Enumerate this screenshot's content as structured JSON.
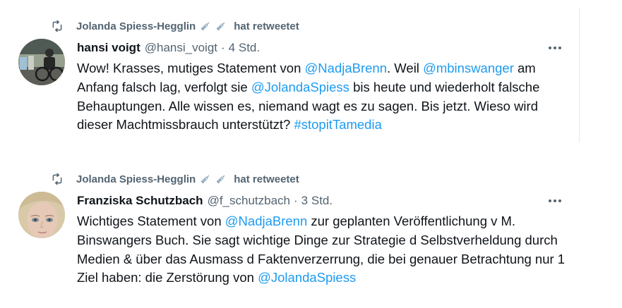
{
  "tweets": [
    {
      "retweeter": "Jolanda Spiess-Hegglin",
      "retweet_suffix": "hat retweetet",
      "author_name": "hansi voigt",
      "author_handle": "@hansi_voigt",
      "separator": "·",
      "time": "4 Std.",
      "text_segments": [
        "Wow! Krasses, mutiges Statement von ",
        "@NadjaBrenn",
        ". Weil ",
        "@mbinswanger",
        " am Anfang falsch lag, verfolgt sie ",
        "@JolandaSpiess",
        " bis heute und wiederholt falsche Behauptungen. Alle wissen es, niemand wagt es zu sagen. Bis jetzt. Wieso wird dieser Machtmissbrauch unterstützt? ",
        "#stopitTamedia"
      ]
    },
    {
      "retweeter": "Jolanda Spiess-Hegglin",
      "retweet_suffix": "hat retweetet",
      "author_name": "Franziska Schutzbach",
      "author_handle": "@f_schutzbach",
      "separator": "·",
      "time": "3 Std.",
      "text_segments": [
        "Wichtiges Statement von ",
        "@NadjaBrenn",
        " zur geplanten Veröffentlichung v M. Binswangers Buch. Sie sagt wichtige Dinge zur Strategie d Selbstverheldung durch Medien & über das Ausmass d Faktenverzerrung, die bei genauer Betrachtung nur 1 Ziel haben: die Zerstörung von ",
        "@JolandaSpiess"
      ]
    }
  ],
  "colors": {
    "link": "#1d9bf0",
    "secondary_text": "#536471",
    "primary_text": "#0f1419",
    "divider": "#e6ecf0"
  },
  "icons": {
    "retweet": "retweet-icon",
    "syringe": "syringe-icon",
    "more": "more-icon"
  }
}
